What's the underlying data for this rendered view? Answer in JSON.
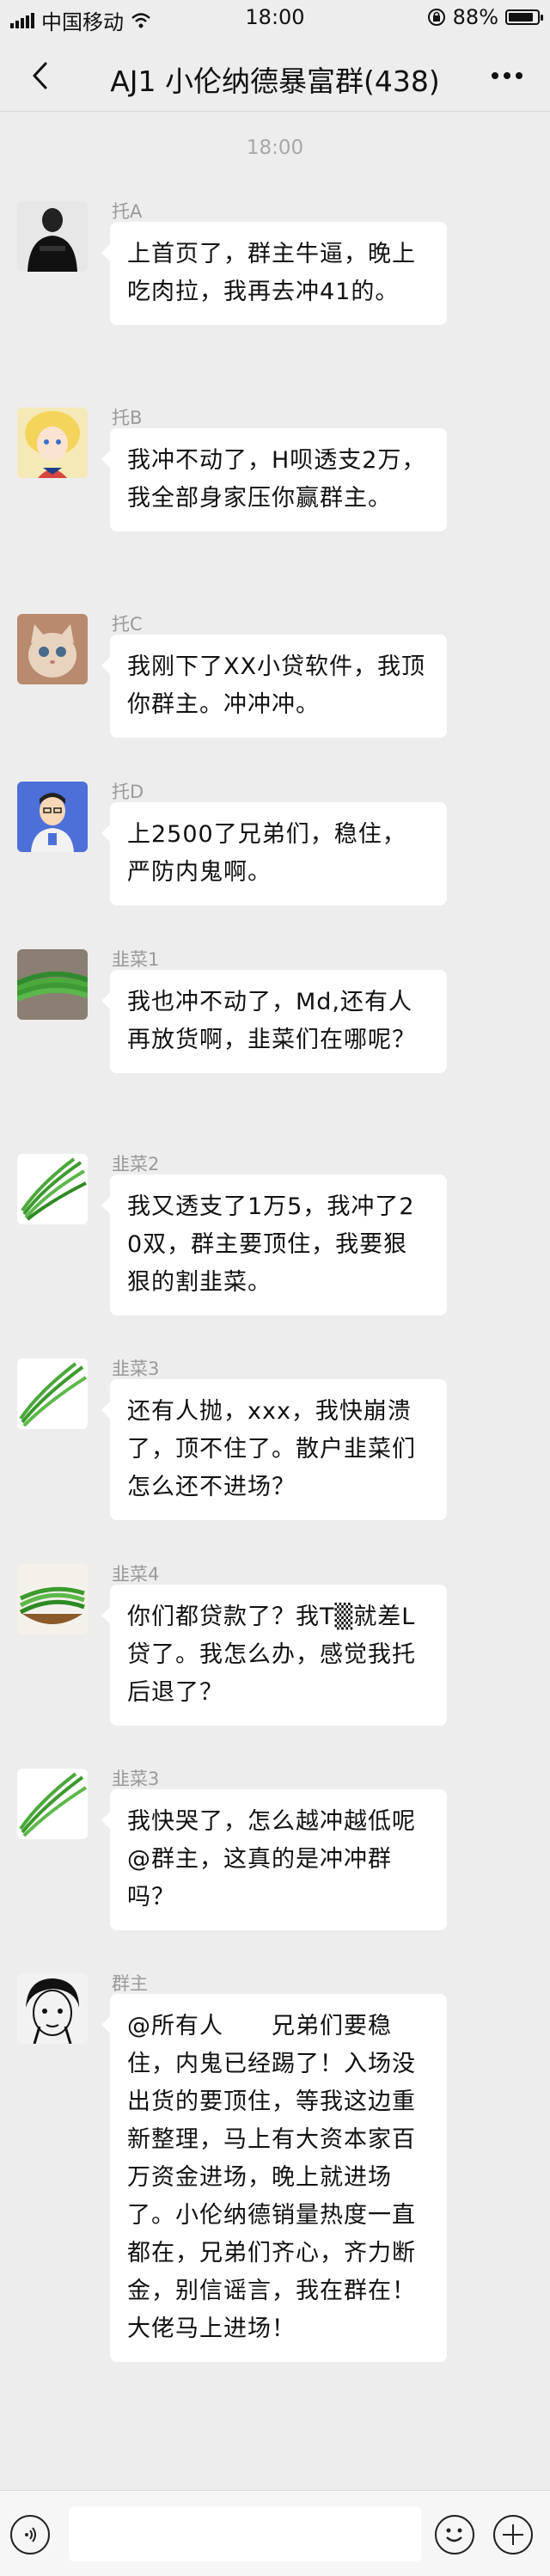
{
  "status_bar": {
    "carrier": "中国移动",
    "time": "18:00",
    "battery": "88%",
    "battery_level": 0.88
  },
  "header": {
    "title": "AJ1 小伦纳德暴富群(438)"
  },
  "chat": {
    "time_divider": "18:00",
    "messages": [
      {
        "sender": "托A",
        "avatar_icon": "person-black-shirt-avatar",
        "text": "上首页了，群主牛逼，晚上吃肉拉，我再去冲41的。"
      },
      {
        "sender": "托B",
        "avatar_icon": "anime-girl-avatar",
        "text": "我冲不动了，H呗透支2万，我全部身家压你赢群主。"
      },
      {
        "sender": "托C",
        "avatar_icon": "cat-avatar",
        "text": "我刚下了XX小贷软件，我顶你群主。冲冲冲。"
      },
      {
        "sender": "托D",
        "avatar_icon": "cartoon-man-avatar",
        "text": "上2500了兄弟们，稳住，严防内鬼啊。"
      },
      {
        "sender": "韭菜1",
        "avatar_icon": "chives-avatar",
        "text": "我也冲不动了，Md,还有人再放货啊，韭菜们在哪呢？"
      },
      {
        "sender": "韭菜2",
        "avatar_icon": "chives-avatar",
        "text": "我又透支了1万5，我冲了20双，群主要顶住，我要狠狠的割韭菜。"
      },
      {
        "sender": "韭菜3",
        "avatar_icon": "chives-avatar",
        "text": "还有人抛，xxx，我快崩溃了，顶不住了。散户韭菜们怎么还不进场？"
      },
      {
        "sender": "韭菜4",
        "avatar_icon": "chives-bowl-avatar",
        "text": "你们都贷款了？我T▒就差L贷了。我怎么办，感觉我托后退了？"
      },
      {
        "sender": "韭菜3",
        "avatar_icon": "chives-avatar",
        "text": "我快哭了，怎么越冲越低呢@群主，这真的是冲冲群吗？"
      },
      {
        "sender": "群主",
        "avatar_icon": "sketch-face-avatar",
        "text": "@所有人　　兄弟们要稳住，内鬼已经踢了！入场没出货的要顶住，等我这边重新整理，马上有大资本家百万资金进场，晚上就进场了。小伦纳德销量热度一直都在，兄弟们齐心，齐力断金，别信谣言，我在群在！大佬马上进场！"
      }
    ]
  },
  "input_bar": {
    "placeholder": ""
  }
}
